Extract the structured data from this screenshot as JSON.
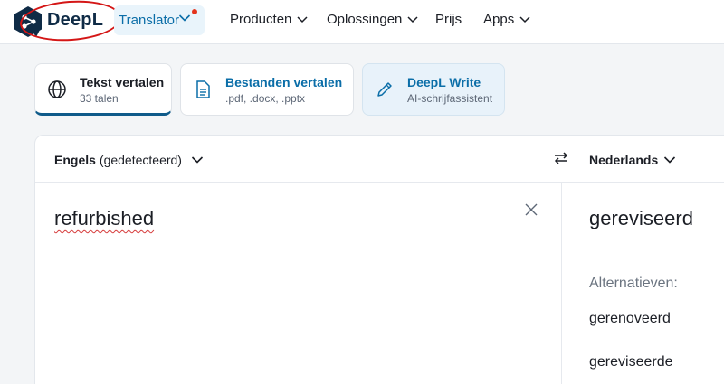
{
  "header": {
    "brand": "DeepL",
    "translator_label": "Translator",
    "nav": [
      {
        "label": "Producten"
      },
      {
        "label": "Oplossingen"
      },
      {
        "label": "Prijs"
      },
      {
        "label": "Apps"
      }
    ]
  },
  "modes": [
    {
      "title": "Tekst vertalen",
      "subtitle": "33 talen"
    },
    {
      "title": "Bestanden vertalen",
      "subtitle": ".pdf, .docx, .pptx"
    },
    {
      "title": "DeepL Write",
      "subtitle": "AI-schrijfassistent"
    }
  ],
  "translator": {
    "source_lang": "Engels",
    "source_detected": "(gedetecteerd)",
    "target_lang": "Nederlands",
    "source_text": "refurbished",
    "target_text": "gereviseerd",
    "alternatives_label": "Alternatieven:",
    "alternatives": [
      "gerenoveerd",
      "gereviseerde"
    ]
  },
  "colors": {
    "accent_blue": "#0b6ea8",
    "brand_navy": "#0f2b46",
    "highlight_circle": "#d41616",
    "notification_dot": "#e4331b"
  },
  "icons": {
    "logo": "deepl-logo-icon",
    "text_mode": "globe-icon",
    "file_mode": "document-icon",
    "write_mode": "pencil-icon",
    "swap": "swap-arrows-icon",
    "clear": "close-icon"
  }
}
